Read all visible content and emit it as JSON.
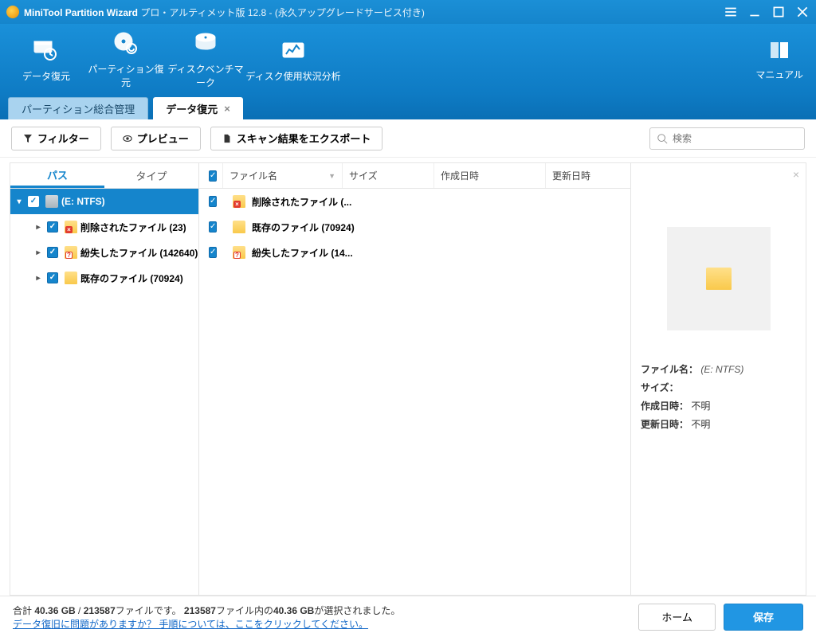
{
  "titlebar": {
    "product": "MiniTool Partition Wizard",
    "edition": "プロ・アルティメット版 12.8 - (永久アップグレードサービス付き)"
  },
  "ribbon": {
    "items": [
      {
        "label": "データ復元"
      },
      {
        "label": "パーティション復元"
      },
      {
        "label": "ディスクベンチマーク"
      },
      {
        "label": "ディスク使用状況分析"
      }
    ],
    "manual": "マニュアル"
  },
  "tabs": {
    "inactive": "パーティション総合管理",
    "active": "データ復元"
  },
  "toolbar": {
    "filter": "フィルター",
    "preview": "プレビュー",
    "export": "スキャン結果をエクスポート",
    "search_placeholder": "検索"
  },
  "tree": {
    "tabs": {
      "path": "パス",
      "type": "タイプ"
    },
    "root": "(E: NTFS)",
    "children": [
      {
        "label": "削除されたファイル (23)",
        "badge": "x"
      },
      {
        "label": "紛失したファイル (142640)",
        "badge": "?"
      },
      {
        "label": "既存のファイル (70924)",
        "badge": ""
      }
    ]
  },
  "list": {
    "columns": {
      "name": "ファイル名",
      "size": "サイズ",
      "created": "作成日時",
      "modified": "更新日時"
    },
    "rows": [
      {
        "label": "削除されたファイル (...",
        "badge": "x"
      },
      {
        "label": "既存のファイル (70924)",
        "badge": ""
      },
      {
        "label": "紛失したファイル (14...",
        "badge": "?"
      }
    ]
  },
  "preview": {
    "labels": {
      "filename": "ファイル名：",
      "size": "サイズ：",
      "created": "作成日時：",
      "modified": "更新日時："
    },
    "filename": "(E: NTFS)",
    "size": "",
    "created": "不明",
    "modified": "不明"
  },
  "footer": {
    "line1_a": "合計 ",
    "line1_b": "40.36 GB",
    "line1_c": " / ",
    "line1_d": "213587",
    "line1_e": "ファイルです。 ",
    "line1_f": "213587",
    "line1_g": "ファイル内の",
    "line1_h": "40.36 GB",
    "line1_i": "が選択されました。",
    "link": "データ復旧に問題がありますか？ 手順については、ここをクリックしてください。",
    "home": "ホーム",
    "save": "保存"
  }
}
